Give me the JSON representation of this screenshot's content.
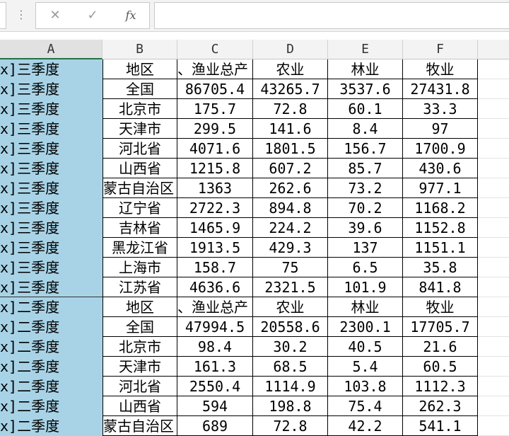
{
  "toolbar": {
    "more_glyph": "⋮",
    "cancel_glyph": "✕",
    "enter_glyph": "✓",
    "fx_label": "fx"
  },
  "columns": [
    "A",
    "B",
    "C",
    "D",
    "E",
    "F"
  ],
  "rows": [
    {
      "a": "x]三季度",
      "b": "地区",
      "c": "、渔业总产",
      "d": "农业",
      "e": "林业",
      "f": "牧业",
      "hdr": true
    },
    {
      "a": "x]三季度",
      "b": "全国",
      "c": "86705.4",
      "d": "43265.7",
      "e": "3537.6",
      "f": "27431.8"
    },
    {
      "a": "x]三季度",
      "b": "北京市",
      "c": "175.7",
      "d": "72.8",
      "e": "60.1",
      "f": "33.3"
    },
    {
      "a": "x]三季度",
      "b": "天津市",
      "c": "299.5",
      "d": "141.6",
      "e": "8.4",
      "f": "97"
    },
    {
      "a": "x]三季度",
      "b": "河北省",
      "c": "4071.6",
      "d": "1801.5",
      "e": "156.7",
      "f": "1700.9"
    },
    {
      "a": "x]三季度",
      "b": "山西省",
      "c": "1215.8",
      "d": "607.2",
      "e": "85.7",
      "f": "430.6"
    },
    {
      "a": "x]三季度",
      "b": "蒙古自治区",
      "c": "1363",
      "d": "262.6",
      "e": "73.2",
      "f": "977.1",
      "clip": true
    },
    {
      "a": "x]三季度",
      "b": "辽宁省",
      "c": "2722.3",
      "d": "894.8",
      "e": "70.2",
      "f": "1168.2"
    },
    {
      "a": "x]三季度",
      "b": "吉林省",
      "c": "1465.9",
      "d": "224.2",
      "e": "39.6",
      "f": "1152.8"
    },
    {
      "a": "x]三季度",
      "b": "黑龙江省",
      "c": "1913.5",
      "d": "429.3",
      "e": "137",
      "f": "1151.1"
    },
    {
      "a": "x]三季度",
      "b": "上海市",
      "c": "158.7",
      "d": "75",
      "e": "6.5",
      "f": "35.8"
    },
    {
      "a": "x]三季度",
      "b": "江苏省",
      "c": "4636.6",
      "d": "2321.5",
      "e": "101.9",
      "f": "841.8"
    },
    {
      "a": "x]二季度",
      "b": "地区",
      "c": "、渔业总产",
      "d": "农业",
      "e": "林业",
      "f": "牧业",
      "hdr": true
    },
    {
      "a": "x]二季度",
      "b": "全国",
      "c": "47994.5",
      "d": "20558.6",
      "e": "2300.1",
      "f": "17705.7"
    },
    {
      "a": "x]二季度",
      "b": "北京市",
      "c": "98.4",
      "d": "30.2",
      "e": "40.5",
      "f": "21.6"
    },
    {
      "a": "x]二季度",
      "b": "天津市",
      "c": "161.3",
      "d": "68.5",
      "e": "5.4",
      "f": "60.5"
    },
    {
      "a": "x]二季度",
      "b": "河北省",
      "c": "2550.4",
      "d": "1114.9",
      "e": "103.8",
      "f": "1112.3"
    },
    {
      "a": "x]二季度",
      "b": "山西省",
      "c": "594",
      "d": "198.8",
      "e": "75.4",
      "f": "262.3"
    },
    {
      "a": "x]二季度",
      "b": "蒙古自治区",
      "c": "689",
      "d": "72.8",
      "e": "42.2",
      "f": "541.1",
      "clip": true
    }
  ]
}
